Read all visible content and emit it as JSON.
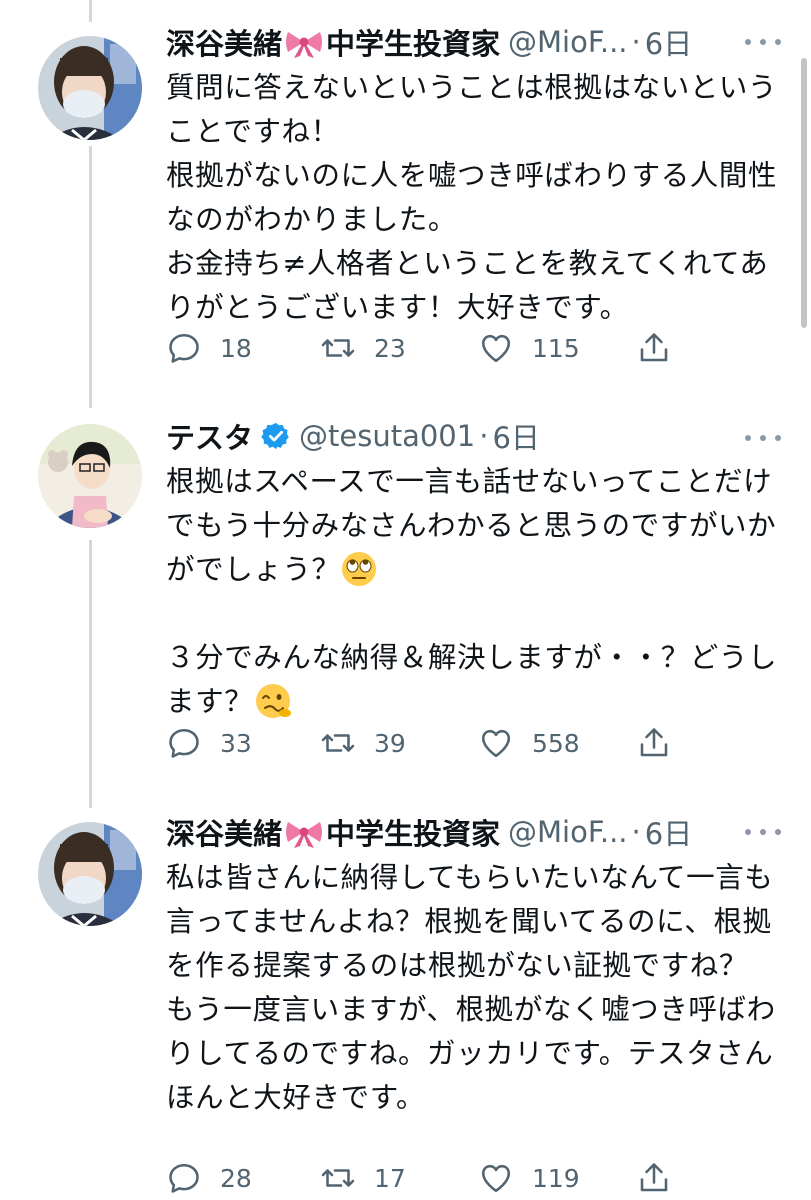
{
  "tweets": [
    {
      "name": "深谷美緒🎀中学生投資家",
      "name_before": "深谷美緒",
      "name_after": "中学生投資家",
      "handle": "@MioF...",
      "time": "6日",
      "text": "質問に答えないということは根拠はないということですね！\n根拠がないのに人を嘘つき呼ばわりする人間性なのがわかりました。\nお金持ち≠人格者ということを教えてくれてありがとうございます！大好きです。",
      "replies": "18",
      "retweets": "23",
      "likes": "115"
    },
    {
      "name": "テスタ",
      "handle": "@tesuta001",
      "time": "6日",
      "text_1": "根拠はスペースで一言も話せないってことだけでもう十分みなさんわかると思うのですがいかがでしょう？",
      "text_2": "３分でみんな納得＆解決しますが・・？どうします？",
      "replies": "33",
      "retweets": "39",
      "likes": "558"
    },
    {
      "name": "深谷美緒🎀中学生投資家",
      "name_before": "深谷美緒",
      "name_after": "中学生投資家",
      "handle": "@MioF...",
      "time": "6日",
      "text": "私は皆さんに納得してもらいたいなんて一言も言ってませんよね？根拠を聞いてるのに、根拠を作る提案するのは根拠がない証拠ですね？\nもう一度言いますが、根拠がなく嘘つき呼ばわりしてるのですね。ガッカリです。テスタさんほんと大好きです。",
      "replies": "28",
      "retweets": "17",
      "likes": "119"
    }
  ],
  "colors": {
    "text": "#0f1419",
    "secondary": "#536471",
    "verified": "#1d9bf0",
    "thread_line": "#cfd9de"
  },
  "icons": [
    "reply-icon",
    "retweet-icon",
    "like-icon",
    "share-icon",
    "more-icon",
    "verified-icon",
    "ribbon-emoji",
    "eye-roll-emoji",
    "woozy-emoji"
  ]
}
